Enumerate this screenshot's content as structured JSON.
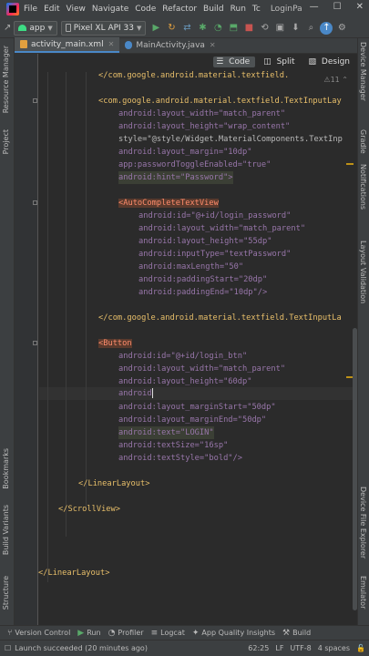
{
  "menu": {
    "items": [
      "File",
      "Edit",
      "View",
      "Navigate",
      "Code",
      "Refactor",
      "Build",
      "Run",
      "Tc"
    ],
    "window_title": "LoginPa",
    "window_controls": [
      "minimize-icon",
      "maximize-icon",
      "close-icon"
    ]
  },
  "toolbar": {
    "module": "app",
    "device": "Pixel XL API 33"
  },
  "tabs": [
    {
      "label": "activity_main.xml",
      "active": true
    },
    {
      "label": "MainActivity.java",
      "active": false
    }
  ],
  "editor": {
    "view_modes": [
      "Code",
      "Split",
      "Design"
    ],
    "active_view": "Code",
    "warning_badge": "11",
    "lines": [
      "</com.google.android.material.textfield.",
      "<com.google.android.material.textfield.TextInputLay",
      "android:layout_width=\"match_parent\"",
      "android:layout_height=\"wrap_content\"",
      "style=\"@style/Widget.MaterialComponents.TextInp",
      "android:layout_margin=\"10dp\"",
      "app:passwordToggleEnabled=\"true\"",
      "android:hint=\"Password\">",
      "<AutoCompleteTextView",
      "android:id=\"@+id/login_password\"",
      "android:layout_width=\"match_parent\"",
      "android:layout_height=\"55dp\"",
      "android:inputType=\"textPassword\"",
      "android:maxLength=\"50\"",
      "android:paddingStart=\"20dp\"",
      "android:paddingEnd=\"10dp\"/>",
      "</com.google.android.material.textfield.TextInputLa",
      "<Button",
      "android:id=\"@+id/login_btn\"",
      "android:layout_width=\"match_parent\"",
      "android:layout_height=\"60dp\"",
      "android",
      "android:layout_marginStart=\"50dp\"",
      "android:layout_marginEnd=\"50dp\"",
      "android:text=\"LOGIN\"",
      "android:textSize=\"16sp\"",
      "android:textStyle=\"bold\"/>",
      "</LinearLayout>",
      "</ScrollView>",
      "</LinearLayout>"
    ]
  },
  "side_panels": {
    "left": [
      "Resource Manager",
      "Project",
      "Bookmarks",
      "Build Variants",
      "Structure"
    ],
    "right": [
      "Device Manager",
      "Gradle",
      "Notifications",
      "Layout Validation",
      "Device File Explorer",
      "Emulator"
    ]
  },
  "bottom_tools": [
    "Version Control",
    "Run",
    "Profiler",
    "Logcat",
    "App Quality Insights",
    "Build"
  ],
  "status": {
    "message": "Launch succeeded (20 minutes ago)",
    "position": "62:25",
    "line_sep": "LF",
    "encoding": "UTF-8",
    "indent": "4 spaces"
  }
}
